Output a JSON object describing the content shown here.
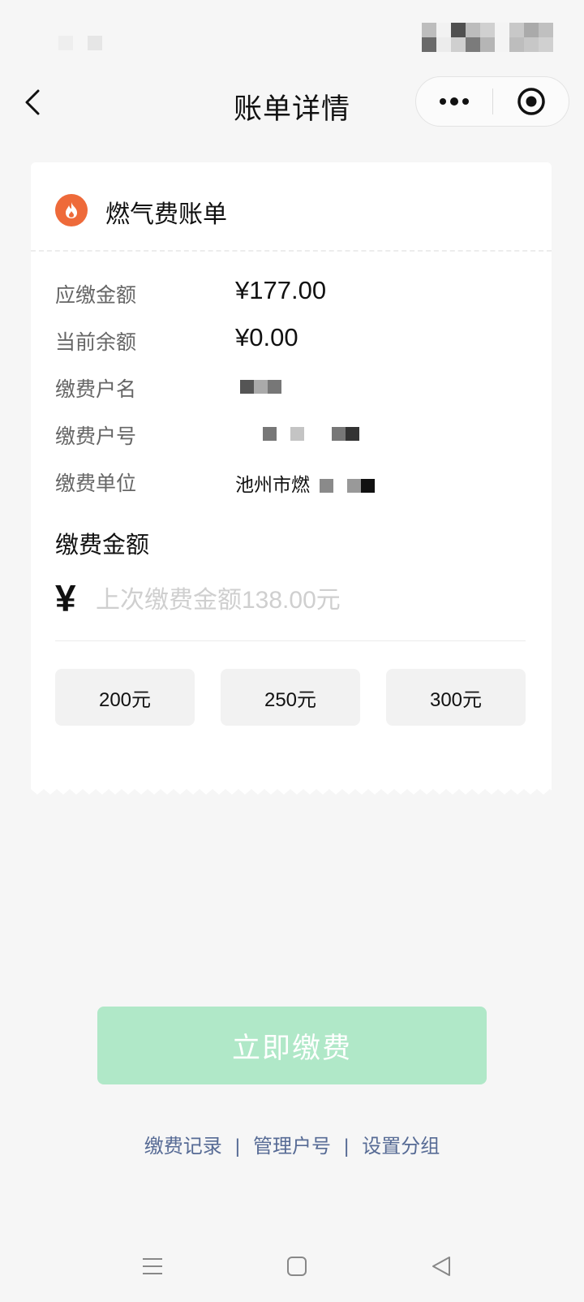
{
  "nav": {
    "title": "账单详情"
  },
  "bill": {
    "title": "燃气费账单",
    "rows": [
      {
        "label": "应缴金额",
        "value": "¥177.00"
      },
      {
        "label": "当前余额",
        "value": "¥0.00"
      },
      {
        "label": "缴费户名",
        "value": ""
      },
      {
        "label": "缴费户号",
        "value": ""
      },
      {
        "label": "缴费单位",
        "value": "池州市燃"
      }
    ],
    "amount_section_title": "缴费金额",
    "currency_symbol": "¥",
    "amount_placeholder": "上次缴费金额138.00元",
    "quick_amounts": [
      "200元",
      "250元",
      "300元"
    ]
  },
  "pay_button": "立即缴费",
  "footer_links": [
    "缴费记录",
    "管理户号",
    "设置分组"
  ],
  "footer_separator": "|",
  "colors": {
    "accent_orange": "#ee6a3a",
    "pay_button_disabled": "#b0e8c8",
    "link": "#576b95"
  },
  "icons": {
    "back": "chevron-left-icon",
    "more": "more-dots-icon",
    "close": "target-close-icon",
    "bill": "flame-icon",
    "android_menu": "menu-icon",
    "android_home": "square-home-icon",
    "android_back": "triangle-back-icon"
  }
}
